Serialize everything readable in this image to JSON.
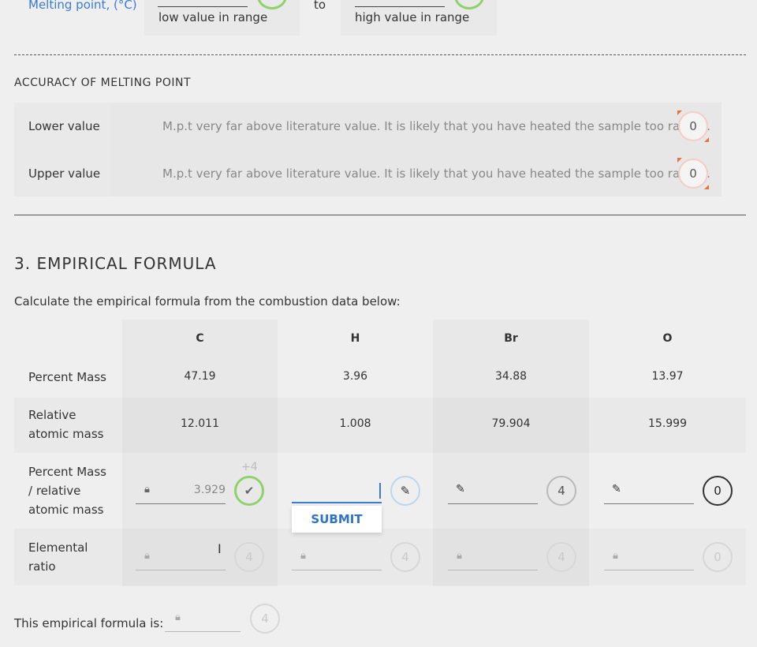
{
  "melting": {
    "label": "Melting point, (°C)",
    "low_hint": "low value in range",
    "to": "to",
    "high_hint": "high value in range"
  },
  "accuracy": {
    "heading": "ACCURACY OF MELTING POINT",
    "rows": [
      {
        "label": "Lower value",
        "message": "M.p.t very far above literature value. It is likely that you have heated the sample too rapidly.",
        "score": "0"
      },
      {
        "label": "Upper value",
        "message": "M.p.t very far above literature value. It is likely that you have heated the sample too rapidly.",
        "score": "0"
      }
    ]
  },
  "section3": {
    "title": "3. EMPIRICAL FORMULA",
    "instruction": "Calculate the empirical formula from the combustion data below:",
    "elements": [
      "C",
      "H",
      "Br",
      "O"
    ],
    "rows": {
      "percent_mass": {
        "label": "Percent Mass",
        "values": [
          "47.19",
          "3.96",
          "34.88",
          "13.97"
        ]
      },
      "relative_atomic_mass": {
        "label_line1": "Relative",
        "label_line2": "atomic mass",
        "values": [
          "12.011",
          "1.008",
          "79.904",
          "15.999"
        ]
      },
      "ratio": {
        "label_line1": "Percent Mass",
        "label_line2": "/ relative",
        "label_line3": "atomic mass",
        "c_value": "3.929",
        "c_bonus": "+4",
        "scores": [
          "",
          "",
          "4",
          "0"
        ]
      },
      "elemental": {
        "label_line1": "Elemental",
        "label_line2": "ratio",
        "scores": [
          "4",
          "4",
          "4",
          "0"
        ]
      }
    },
    "submit_label": "SUBMIT",
    "formula_label": "This empirical formula is:",
    "formula_score": "4"
  },
  "colors": {
    "accent_blue": "#3a7bd5",
    "green": "#8fd16a",
    "pink": "#f3cdc7",
    "corner_orange": "#e8743b"
  }
}
